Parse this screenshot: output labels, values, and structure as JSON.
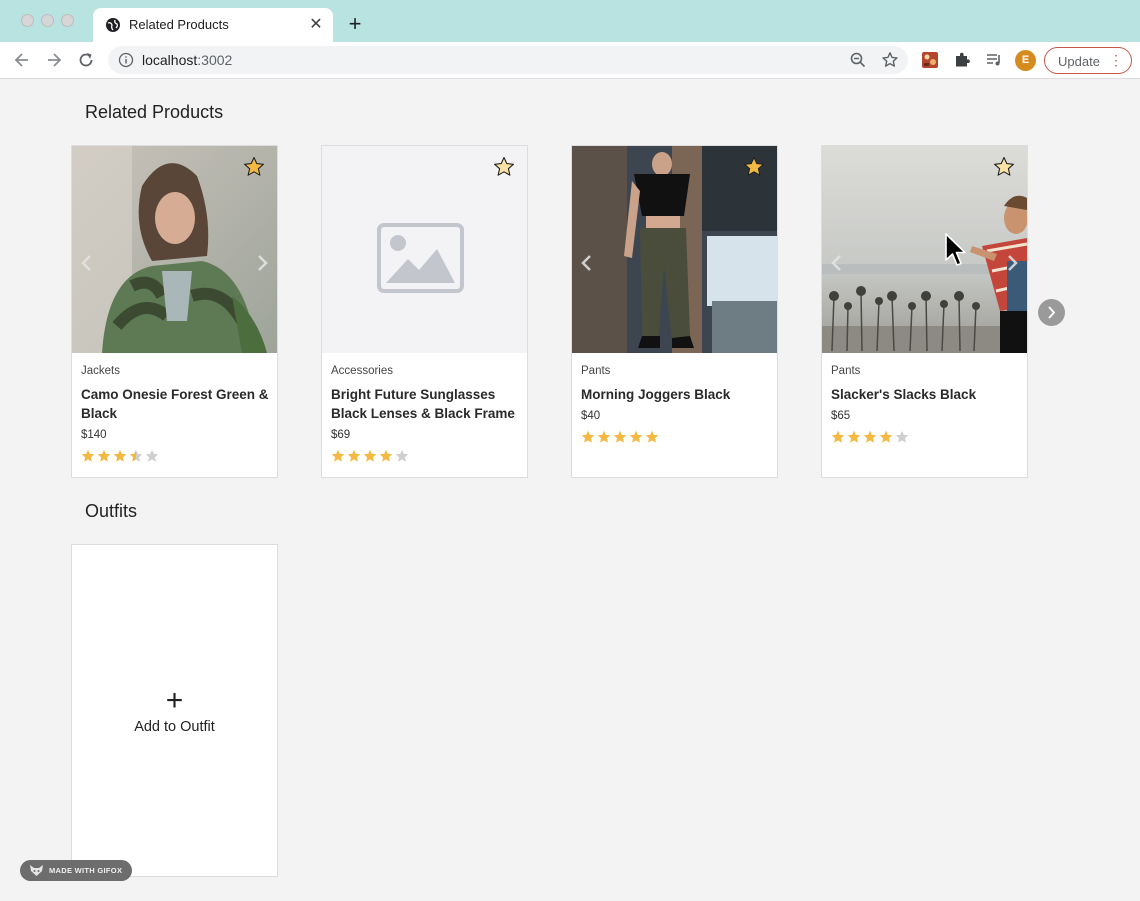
{
  "browser": {
    "tab_title": "Related Products",
    "url_host": "localhost",
    "url_port": ":3002",
    "profile_initial": "E",
    "update_label": "Update"
  },
  "colors": {
    "titlebar": "#b9e3e1",
    "page_bg": "#f3f3f3",
    "star_filled": "#f4b942",
    "star_empty": "#cfcfcf"
  },
  "related": {
    "title": "Related Products",
    "products": [
      {
        "category": "Jackets",
        "name": "Camo Onesie Forest Green & Black",
        "price": "$140",
        "rating": 3.5,
        "favorited": true
      },
      {
        "category": "Accessories",
        "name": "Bright Future Sunglasses Black Lenses & Black Frame",
        "price": "$69",
        "rating": 4,
        "favorited": false
      },
      {
        "category": "Pants",
        "name": "Morning Joggers Black",
        "price": "$40",
        "rating": 5,
        "favorited": true
      },
      {
        "category": "Pants",
        "name": "Slacker's Slacks Black",
        "price": "$65",
        "rating": 4,
        "favorited": false
      }
    ]
  },
  "outfits": {
    "title": "Outfits",
    "add_icon": "+",
    "add_label": "Add to Outfit"
  },
  "watermark": "MADE WITH GIFOX"
}
